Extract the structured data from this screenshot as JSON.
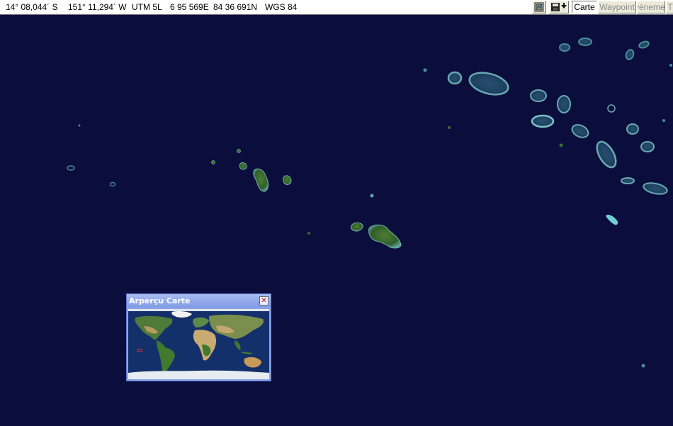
{
  "statusbar": {
    "latitude": "14° 08,044´ S",
    "longitude": "151° 11,294´ W",
    "utm_zone": "UTM  5L",
    "easting": "6 95 569E",
    "northing": "84 36 691N",
    "datum": "WGS 84"
  },
  "toolbar": {
    "map_icon": "map-icon",
    "save_icon": "save-dropdown-icon",
    "tabs": [
      {
        "label": "Carte",
        "active": true
      },
      {
        "label": "Waypoint",
        "active": false
      },
      {
        "label": "vèneme",
        "active": false
      },
      {
        "label": "T",
        "active": false
      }
    ]
  },
  "overview": {
    "title": "Arperçu Carte",
    "close_icon": "close-icon"
  },
  "colors": {
    "ocean": "#0b0e3c",
    "island_green": "#3f7a2f",
    "reef": "#4a8d9a",
    "overview_frame": "#8fa6e6",
    "locator_red": "#ff2020"
  }
}
